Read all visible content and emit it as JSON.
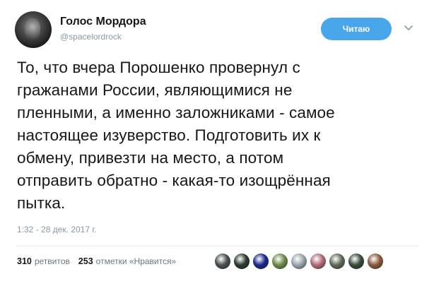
{
  "author": {
    "name": "Голос Мордора",
    "handle": "@spacelordrock"
  },
  "follow_button_label": "Читаю",
  "tweet_lines": [
    "То, что вчера Порошенко провернул с",
    "гражанами России, являющимися не",
    "пленными, а именно заложниками - самое",
    "настоящее изуверство. Подготовить их к",
    "обмену, привезти на место, а потом",
    "отправить обратно - какая-то изощрённая",
    "пытка."
  ],
  "timestamp": "1:32 - 28 дек. 2017 г.",
  "stats": {
    "retweets_count": "310",
    "retweets_label": "ретвитов",
    "likes_count": "253",
    "likes_label": "отметки «Нравится»"
  },
  "likers": [
    {
      "icon": "liker-avatar-1",
      "color": "#4a4f52"
    },
    {
      "icon": "liker-avatar-2",
      "color": "#2b3a2e"
    },
    {
      "icon": "liker-avatar-3",
      "color": "#1a2a8a"
    },
    {
      "icon": "liker-avatar-4",
      "color": "#6d8a4a"
    },
    {
      "icon": "liker-avatar-5",
      "color": "#9aa5ad"
    },
    {
      "icon": "liker-avatar-6",
      "color": "#b06a7a"
    },
    {
      "icon": "liker-avatar-7",
      "color": "#5e6a5a"
    },
    {
      "icon": "liker-avatar-8",
      "color": "#3a4a3a"
    },
    {
      "icon": "liker-avatar-9",
      "color": "#8a5a3a"
    }
  ],
  "colors": {
    "follow_button": "#4aa6ea",
    "secondary_text": "#8899a6"
  }
}
